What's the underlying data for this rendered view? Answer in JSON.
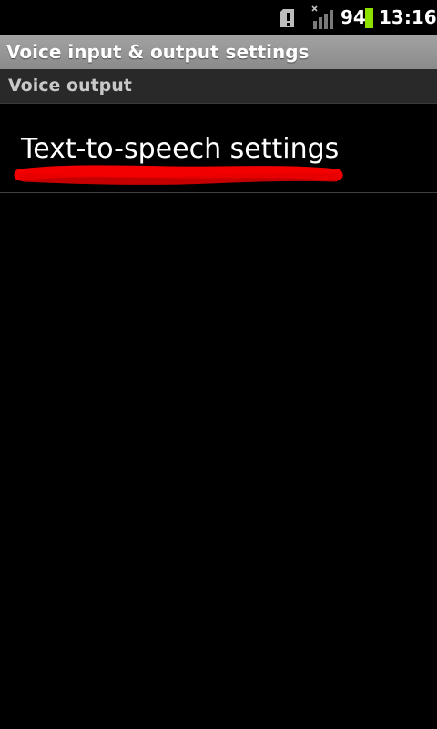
{
  "status_bar": {
    "battery_level": "94",
    "time": "13:16",
    "icons": [
      "sd-card-warning-icon",
      "signal-no-service-icon",
      "battery-icon"
    ],
    "battery_color": "#8ee000"
  },
  "title_bar": {
    "title": "Voice input & output settings"
  },
  "category": {
    "label": "Voice output"
  },
  "items": [
    {
      "label": "Text-to-speech settings",
      "annotation_color": "#ff0000"
    }
  ]
}
